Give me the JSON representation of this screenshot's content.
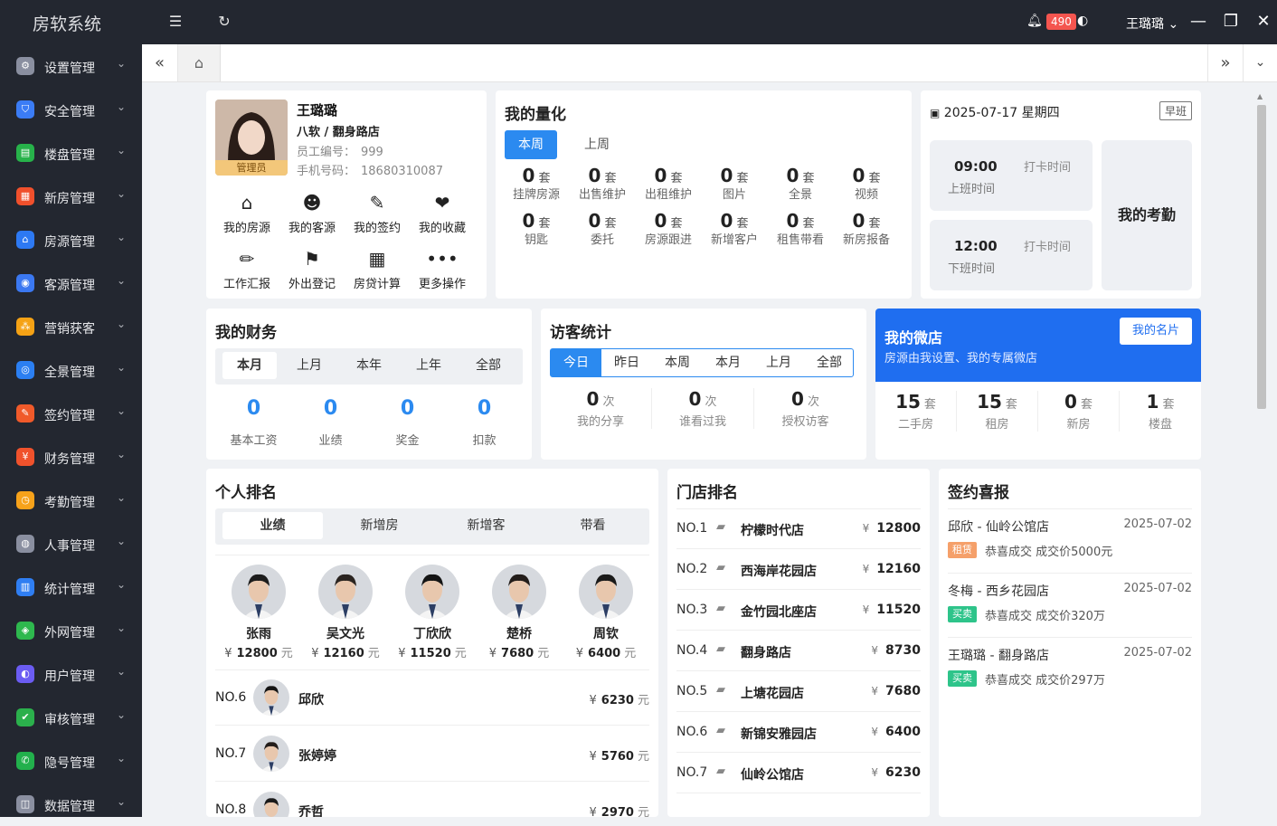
{
  "app": {
    "title": "房软系统",
    "notify_count": "490",
    "user_name": "王璐璐"
  },
  "sidebar": {
    "items": [
      {
        "label": "设置管理",
        "color": "#8a8fa0"
      },
      {
        "label": "安全管理",
        "color": "#3b7cf5"
      },
      {
        "label": "楼盘管理",
        "color": "#27b24a"
      },
      {
        "label": "新房管理",
        "color": "#f0502c"
      },
      {
        "label": "房源管理",
        "color": "#2d79f3"
      },
      {
        "label": "客源管理",
        "color": "#3b78f1"
      },
      {
        "label": "营销获客",
        "color": "#f5a215"
      },
      {
        "label": "全景管理",
        "color": "#2b7ff2"
      },
      {
        "label": "签约管理",
        "color": "#f05a2a"
      },
      {
        "label": "财务管理",
        "color": "#f0522c"
      },
      {
        "label": "考勤管理",
        "color": "#f7a21a"
      },
      {
        "label": "人事管理",
        "color": "#8a8fa0"
      },
      {
        "label": "统计管理",
        "color": "#2f7ef2"
      },
      {
        "label": "外网管理",
        "color": "#2eb84e"
      },
      {
        "label": "用户管理",
        "color": "#6b5cf2"
      },
      {
        "label": "审核管理",
        "color": "#2bb04c"
      },
      {
        "label": "隐号管理",
        "color": "#22b04c"
      },
      {
        "label": "数据管理",
        "color": "#8a8fa0"
      }
    ]
  },
  "profile": {
    "name": "王璐璐",
    "company": "八软 / 翻身路店",
    "role": "管理员",
    "emp_label": "员工编号：",
    "emp_no": "999",
    "phone_label": "手机号码：",
    "phone": "18680310087",
    "actions": [
      "我的房源",
      "我的客源",
      "我的签约",
      "我的收藏",
      "工作汇报",
      "外出登记",
      "房贷计算",
      "更多操作"
    ]
  },
  "quant": {
    "title": "我的量化",
    "tabs": [
      "本周",
      "上周"
    ],
    "unit": "套",
    "items": [
      {
        "value": "0",
        "label": "挂牌房源"
      },
      {
        "value": "0",
        "label": "出售维护"
      },
      {
        "value": "0",
        "label": "出租维护"
      },
      {
        "value": "0",
        "label": "图片"
      },
      {
        "value": "0",
        "label": "全景"
      },
      {
        "value": "0",
        "label": "视频"
      },
      {
        "value": "0",
        "label": "钥匙"
      },
      {
        "value": "0",
        "label": "委托"
      },
      {
        "value": "0",
        "label": "房源跟进"
      },
      {
        "value": "0",
        "label": "新增客户"
      },
      {
        "value": "0",
        "label": "租售带看"
      },
      {
        "value": "0",
        "label": "新房报备"
      }
    ]
  },
  "attendance": {
    "date": "2025-07-17 星期四",
    "shift": "早班",
    "title": "我的考勤",
    "on_time": "09:00",
    "on_label": "上班时间",
    "off_time": "12:00",
    "off_label": "下班时间",
    "punch_label": "打卡时间"
  },
  "finance": {
    "title": "我的财务",
    "tabs": [
      "本月",
      "上月",
      "本年",
      "上年",
      "全部"
    ],
    "items": [
      {
        "value": "0",
        "label": "基本工资"
      },
      {
        "value": "0",
        "label": "业绩"
      },
      {
        "value": "0",
        "label": "奖金"
      },
      {
        "value": "0",
        "label": "扣款"
      }
    ]
  },
  "visitors": {
    "title": "访客统计",
    "tabs": [
      "今日",
      "昨日",
      "本周",
      "本月",
      "上月",
      "全部"
    ],
    "unit": "次",
    "items": [
      {
        "value": "0",
        "label": "我的分享"
      },
      {
        "value": "0",
        "label": "谁看过我"
      },
      {
        "value": "0",
        "label": "授权访客"
      }
    ]
  },
  "shop": {
    "title": "我的微店",
    "subtitle": "房源由我设置、我的专属微店",
    "card_btn": "我的名片",
    "unit": "套",
    "items": [
      {
        "value": "15",
        "label": "二手房"
      },
      {
        "value": "15",
        "label": "租房"
      },
      {
        "value": "0",
        "label": "新房"
      },
      {
        "value": "1",
        "label": "楼盘"
      }
    ]
  },
  "personal_rank": {
    "title": "个人排名",
    "tabs": [
      "业绩",
      "新增房",
      "新增客",
      "带看"
    ],
    "currency": "¥",
    "unit": "元",
    "top": [
      {
        "name": "张雨",
        "value": "12800"
      },
      {
        "name": "吴文光",
        "value": "12160"
      },
      {
        "name": "丁欣欣",
        "value": "11520"
      },
      {
        "name": "楚桥",
        "value": "7680"
      },
      {
        "name": "周钦",
        "value": "6400"
      }
    ],
    "rest": [
      {
        "no": "NO.6",
        "name": "邱欣",
        "value": "6230"
      },
      {
        "no": "NO.7",
        "name": "张婷婷",
        "value": "5760"
      },
      {
        "no": "NO.8",
        "name": "乔哲",
        "value": "2970"
      }
    ]
  },
  "store_rank": {
    "title": "门店排名",
    "currency": "¥",
    "items": [
      {
        "no": "NO.1",
        "name": "柠檬时代店",
        "value": "12800"
      },
      {
        "no": "NO.2",
        "name": "西海岸花园店",
        "value": "12160"
      },
      {
        "no": "NO.3",
        "name": "金竹园北座店",
        "value": "11520"
      },
      {
        "no": "NO.4",
        "name": "翻身路店",
        "value": "8730"
      },
      {
        "no": "NO.5",
        "name": "上塘花园店",
        "value": "7680"
      },
      {
        "no": "NO.6",
        "name": "新锦安雅园店",
        "value": "6400"
      },
      {
        "no": "NO.7",
        "name": "仙岭公馆店",
        "value": "6230"
      }
    ]
  },
  "signing": {
    "title": "签约喜报",
    "items": [
      {
        "who": "邱欣 - 仙岭公馆店",
        "date": "2025-07-02",
        "tag": "租赁",
        "tag_color": "#f5a06a",
        "text": "恭喜成交 成交价5000元"
      },
      {
        "who": "冬梅 - 西乡花园店",
        "date": "2025-07-02",
        "tag": "买卖",
        "tag_color": "#2ec48a",
        "text": "恭喜成交 成交价320万"
      },
      {
        "who": "王璐璐 - 翻身路店",
        "date": "2025-07-02",
        "tag": "买卖",
        "tag_color": "#2ec48a",
        "text": "恭喜成交 成交价297万"
      }
    ]
  }
}
